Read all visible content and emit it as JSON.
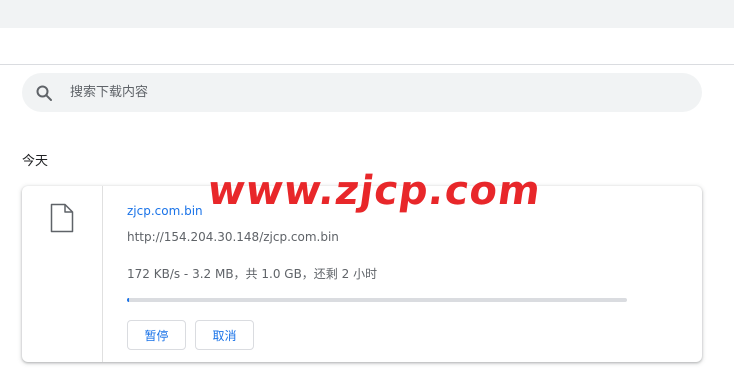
{
  "search": {
    "placeholder": "搜索下载内容"
  },
  "section": {
    "title": "今天"
  },
  "download": {
    "file_name": "zjcp.com.bin",
    "url": "http://154.204.30.148/zjcp.com.bin",
    "status": "172 KB/s - 3.2 MB，共 1.0 GB，还剩 2 小时",
    "progress_fraction": 0.003,
    "pause_label": "暂停",
    "cancel_label": "取消"
  },
  "watermark": {
    "text": "www.zjcp.com"
  },
  "colors": {
    "accent": "#1a73e8",
    "watermark": "#e8272a"
  }
}
